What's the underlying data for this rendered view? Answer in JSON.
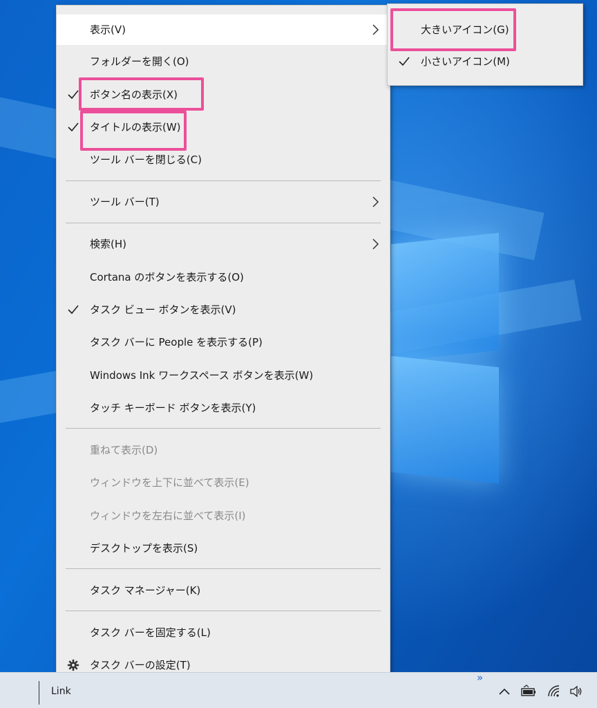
{
  "menu": {
    "items": [
      {
        "label": "表示(V)"
      },
      {
        "label": "フォルダーを開く(O)"
      },
      {
        "label": "ボタン名の表示(X)"
      },
      {
        "label": "タイトルの表示(W)"
      },
      {
        "label": "ツール バーを閉じる(C)"
      },
      {
        "label": "ツール バー(T)"
      },
      {
        "label": "検索(H)"
      },
      {
        "label": "Cortana のボタンを表示する(O)"
      },
      {
        "label": "タスク ビュー ボタンを表示(V)"
      },
      {
        "label": "タスク バーに People を表示する(P)"
      },
      {
        "label": "Windows Ink ワークスペース ボタンを表示(W)"
      },
      {
        "label": "タッチ キーボード ボタンを表示(Y)"
      },
      {
        "label": "重ねて表示(D)"
      },
      {
        "label": "ウィンドウを上下に並べて表示(E)"
      },
      {
        "label": "ウィンドウを左右に並べて表示(I)"
      },
      {
        "label": "デスクトップを表示(S)"
      },
      {
        "label": "タスク マネージャー(K)"
      },
      {
        "label": "タスク バーを固定する(L)"
      },
      {
        "label": "タスク バーの設定(T)"
      }
    ]
  },
  "submenu": {
    "items": [
      {
        "label": "大きいアイコン(G)"
      },
      {
        "label": "小さいアイコン(M)"
      }
    ]
  },
  "taskbar": {
    "link_label": "Link",
    "overflow_glyph": "»"
  },
  "icons": {
    "chevron": "chevron-right-icon",
    "check": "checkmark-icon",
    "gear": "gear-icon",
    "tray_up": "chevron-up-icon",
    "battery": "battery-icon",
    "wifi": "wifi-icon",
    "volume": "volume-icon"
  },
  "colors": {
    "highlight": "#ec4f9a",
    "menu_bg": "#ededed",
    "disabled_text": "#8a8a8a",
    "desktop": "#0a5fc4"
  }
}
